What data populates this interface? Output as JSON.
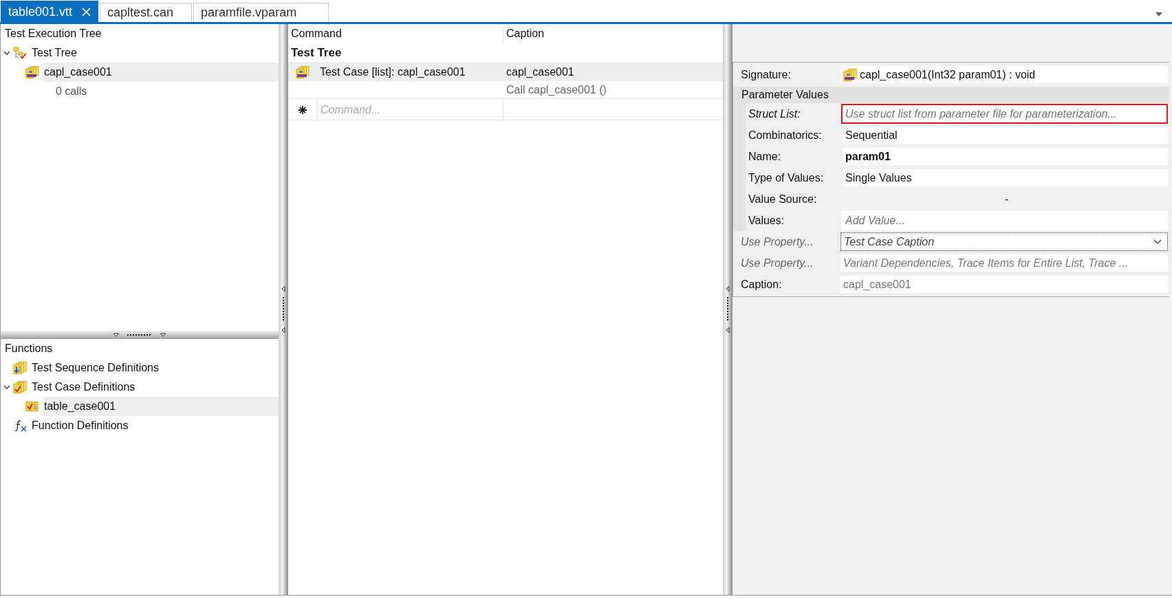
{
  "tabs": [
    {
      "label": "table001.vtt",
      "selected": true
    },
    {
      "label": "capltest.can",
      "selected": false
    },
    {
      "label": "paramfile.vparam",
      "selected": false
    }
  ],
  "execution_tree": {
    "title": "Test Execution Tree",
    "items": [
      {
        "label": "Test Tree",
        "kind": "tree",
        "selected": false,
        "expanded": true,
        "children": [
          {
            "label": "capl_case001",
            "kind": "capl",
            "selected": true,
            "children": [
              {
                "label": "0 calls",
                "kind": "note",
                "selected": false
              }
            ]
          }
        ]
      }
    ]
  },
  "functions": {
    "title": "Functions",
    "items": [
      {
        "label": "Test Sequence Definitions",
        "kind": "sequence",
        "selected": false
      },
      {
        "label": "Test Case Definitions",
        "kind": "case_group",
        "selected": false,
        "expanded": true,
        "children": [
          {
            "label": "table_case001",
            "kind": "case",
            "selected": true
          }
        ]
      },
      {
        "label": "Function Definitions",
        "kind": "function",
        "selected": false
      }
    ]
  },
  "commands": {
    "columns": [
      "Command",
      "Caption"
    ],
    "group": "Test Tree",
    "rows": [
      {
        "kind": "command",
        "command": "Test Case [list]: capl_case001",
        "caption": "capl_case001",
        "selected": true
      },
      {
        "kind": "detail",
        "caption": "Call capl_case001 ()",
        "selected": false
      }
    ],
    "new_row": {
      "placeholder": "Command..."
    }
  },
  "properties": [
    {
      "kind": "signature",
      "label": "Signature:",
      "value": "capl_case001(Int32 param01) : void",
      "label_italic": false
    },
    {
      "kind": "section",
      "label": "Parameter Values",
      "children": [
        {
          "kind": "placeholder",
          "label": "Struct List:",
          "placeholder": "Use struct list from parameter file for parameterization...",
          "label_italic": true,
          "highlighted": true
        },
        {
          "kind": "text",
          "label": "Combinatorics:",
          "value": "Sequential",
          "label_italic": false
        },
        {
          "kind": "bold",
          "label": "Name:",
          "value": "param01",
          "label_italic": false
        },
        {
          "kind": "text",
          "label": "Type of Values:",
          "value": "Single Values",
          "label_italic": false
        },
        {
          "kind": "dash",
          "label": "Value Source:",
          "value": "-",
          "label_italic": false
        },
        {
          "kind": "placeholder",
          "label": "Values:",
          "placeholder": "Add Value...",
          "label_italic": false,
          "highlighted": false
        }
      ]
    },
    {
      "kind": "dropdown",
      "label": "Use Property...",
      "value": "Test Case Caption",
      "label_italic": true
    },
    {
      "kind": "option",
      "label": "Use Property...",
      "value": "Variant Dependencies, Trace Items for Entire List, Trace ...",
      "label_italic": true
    },
    {
      "kind": "muted",
      "label": "Caption:",
      "value": "capl_case001",
      "label_italic": false
    }
  ]
}
